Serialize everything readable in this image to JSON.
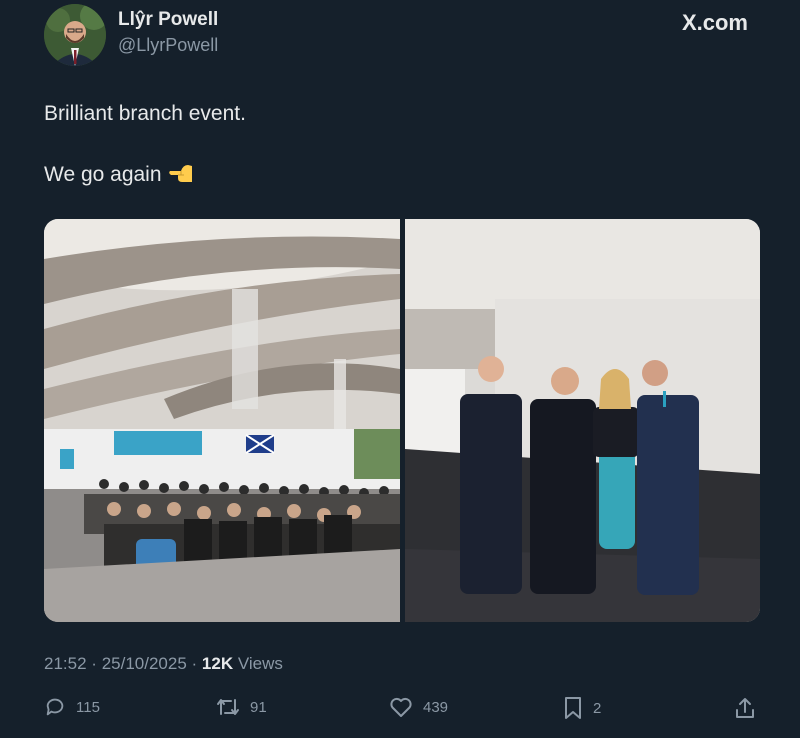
{
  "author": {
    "name": "Llŷr Powell",
    "handle": "@LlyrPowell"
  },
  "brand": "X.com",
  "tweet": {
    "line1": "Brilliant branch event.",
    "line2": "We go again"
  },
  "meta": {
    "time": "21:52",
    "date": "25/10/2025",
    "views_count": "12K",
    "views_label": "Views",
    "sep": "·"
  },
  "actions": {
    "replies": "115",
    "reposts": "91",
    "likes": "439",
    "bookmarks": "2"
  },
  "icons": [
    "reply-icon",
    "repost-icon",
    "like-icon",
    "bookmark-icon",
    "share-icon"
  ],
  "colors": {
    "background": "#15202b",
    "text": "#e7e9ea",
    "muted": "#8b98a5"
  }
}
